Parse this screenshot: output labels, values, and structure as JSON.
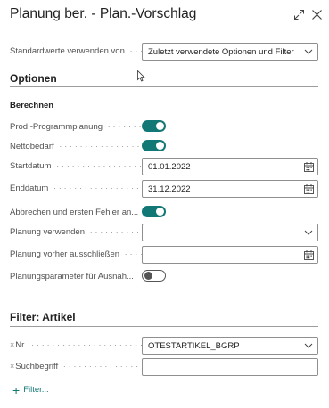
{
  "window": {
    "title": "Planung ber. - Plan.-Vorschlag",
    "expand_icon": "expand-icon",
    "close_icon": "close-icon"
  },
  "standardwerte": {
    "label": "Standardwerte verwenden von",
    "value": "Zuletzt verwendete Optionen und Filter"
  },
  "optionen": {
    "title": "Optionen",
    "group_label": "Berechnen",
    "fields": {
      "prod_programm": {
        "label": "Prod.-Programmplanung",
        "on": true
      },
      "nettobedarf": {
        "label": "Nettobedarf",
        "on": true
      },
      "startdatum": {
        "label": "Startdatum",
        "value": "01.01.2022"
      },
      "enddatum": {
        "label": "Enddatum",
        "value": "31.12.2022"
      },
      "abbrechen": {
        "label": "Abbrechen und ersten Fehler an...",
        "on": true
      },
      "planung_verwenden": {
        "label": "Planung verwenden",
        "value": ""
      },
      "planung_ausschliessen": {
        "label": "Planung vorher ausschließen",
        "value": ""
      },
      "planungsparameter": {
        "label": "Planungsparameter für Ausnah...",
        "on": false
      }
    }
  },
  "filter": {
    "title": "Filter: Artikel",
    "remove_mark": "×",
    "nr": {
      "label": "Nr.",
      "value": "OTESTARTIKEL_BGRP"
    },
    "suchbegriff": {
      "label": "Suchbegriff",
      "value": ""
    },
    "add_label": "Filter..."
  },
  "colors": {
    "accent": "#117875",
    "border": "#8f8f8f",
    "text": "#212121",
    "label": "#505050"
  }
}
